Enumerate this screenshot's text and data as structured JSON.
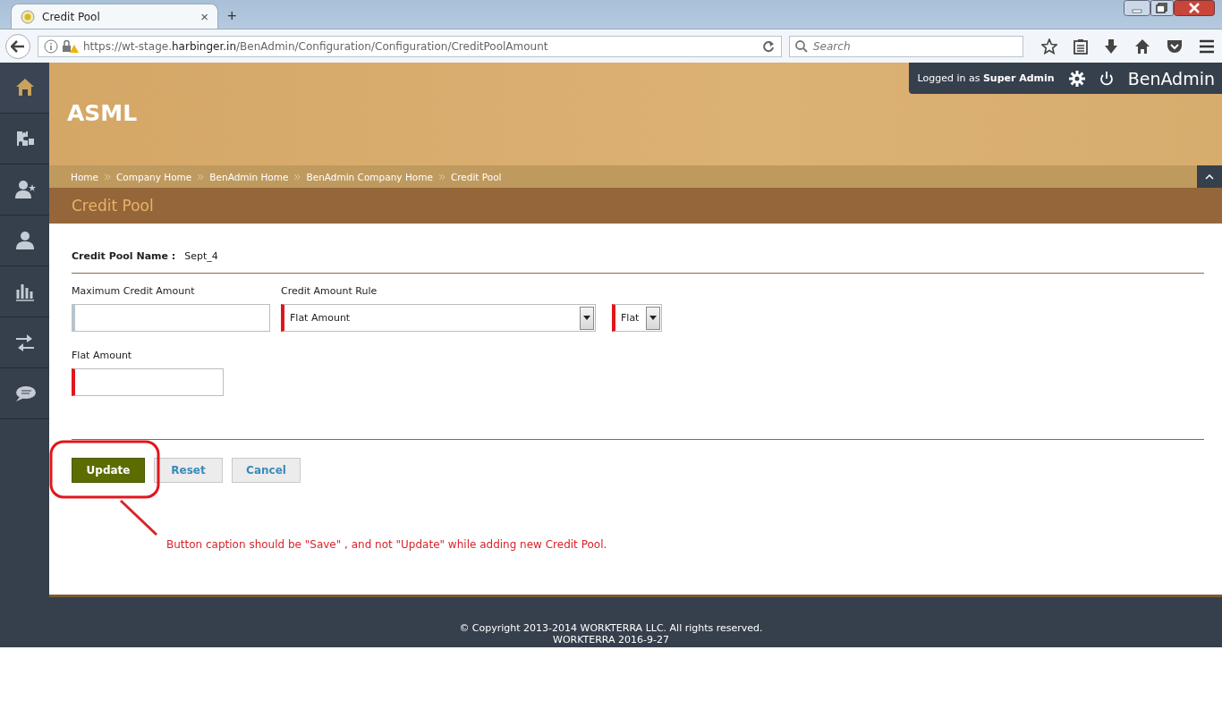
{
  "browser": {
    "tab_title": "Credit Pool",
    "tab_close": "×",
    "new_tab": "+",
    "url_prefix": "https://wt-stage.",
    "url_domain": "harbinger.in",
    "url_path": "/BenAdmin/Configuration/Configuration/CreditPoolAmount",
    "search_placeholder": "Search"
  },
  "user_bar": {
    "logged_in_label": "Logged in as",
    "user": "Super Admin",
    "app_name": "BenAdmin"
  },
  "sidebar": {
    "items": [
      {
        "selected": true
      },
      {
        "selected": false
      },
      {
        "selected": false
      },
      {
        "selected": false
      },
      {
        "selected": false
      },
      {
        "selected": false
      },
      {
        "selected": false
      }
    ]
  },
  "company": "ASML",
  "breadcrumbs": [
    "Home",
    "Company Home",
    "BenAdmin Home",
    "BenAdmin Company Home",
    "Credit Pool"
  ],
  "page_title": "Credit Pool",
  "form": {
    "name_label": "Credit Pool Name :",
    "name_value": "Sept_4",
    "rows": [
      [
        {
          "kind": "input",
          "label": "Maximum Credit Amount",
          "required": false
        },
        {
          "kind": "select",
          "label": "Credit Amount Rule",
          "value": "Flat Amount",
          "required": true
        },
        {
          "kind": "select",
          "value": "Flat",
          "required": true
        }
      ],
      [
        {
          "kind": "input",
          "label": "Flat Amount",
          "required": true
        }
      ]
    ],
    "buttons": [
      {
        "label": "Update",
        "kind": "primary"
      },
      {
        "label": "Reset",
        "kind": "secondary"
      },
      {
        "label": "Cancel",
        "kind": "secondary"
      }
    ]
  },
  "annotation": {
    "text": "Button caption should be \"Save\" , and not  \"Update\" while adding new Credit Pool."
  },
  "footer": {
    "copyright": "© Copyright 2013-2014 WORKTERRA LLC. All rights reserved.",
    "version": "WORKTERRA 2016-9-27"
  }
}
